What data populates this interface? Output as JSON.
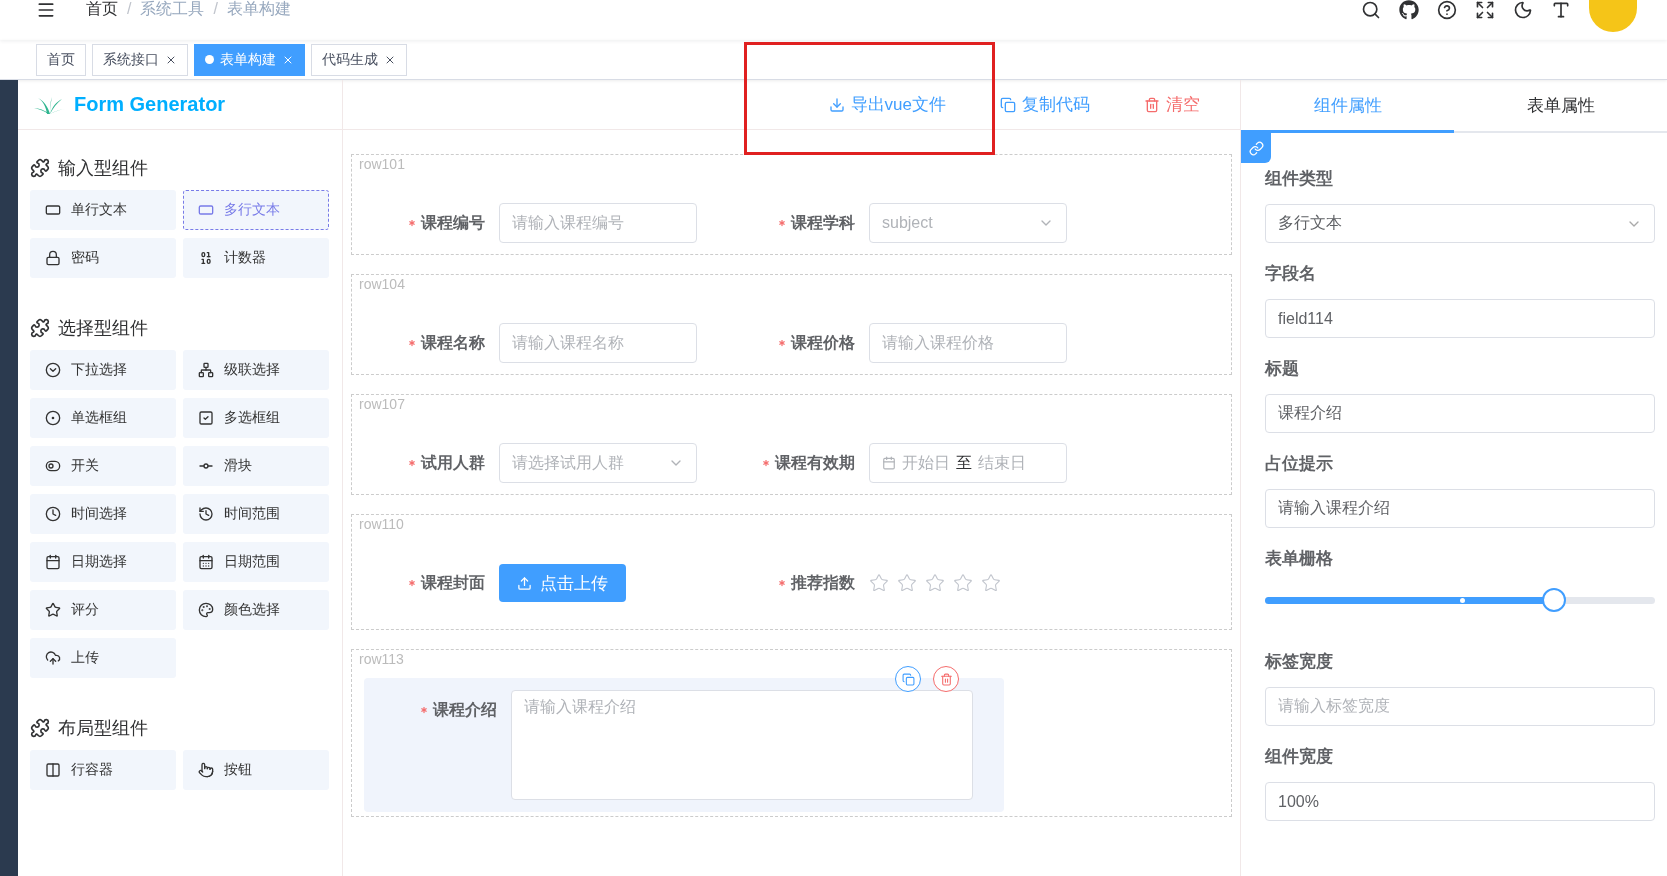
{
  "navbar": {
    "breadcrumb": [
      {
        "label": "首页",
        "link": true
      },
      {
        "separator": "/",
        "label": "系统工具",
        "link": false
      },
      {
        "separator": "/",
        "label": "表单构建",
        "link": false
      }
    ]
  },
  "tags": [
    {
      "label": "首页",
      "selected": false,
      "closable": false
    },
    {
      "label": "系统接口",
      "selected": false,
      "closable": true
    },
    {
      "label": "表单构建",
      "selected": true,
      "closable": true
    },
    {
      "label": "代码生成",
      "selected": false,
      "closable": true
    }
  ],
  "header": {
    "logo": "Form Generator",
    "actions": [
      {
        "kind": "download",
        "label": "导出vue文件"
      },
      {
        "kind": "copy",
        "label": "复制代码"
      },
      {
        "kind": "delete",
        "label": "清空"
      }
    ]
  },
  "palette": [
    {
      "title": "输入型组件",
      "items": [
        {
          "kind": "input",
          "label": "单行文本",
          "selected": false
        },
        {
          "kind": "textarea",
          "label": "多行文本",
          "selected": true
        },
        {
          "kind": "password",
          "label": "密码",
          "selected": false
        },
        {
          "kind": "number",
          "label": "计数器",
          "selected": false
        }
      ]
    },
    {
      "title": "选择型组件",
      "items": [
        {
          "kind": "select",
          "label": "下拉选择",
          "selected": false
        },
        {
          "kind": "cascader",
          "label": "级联选择",
          "selected": false
        },
        {
          "kind": "radio",
          "label": "单选框组",
          "selected": false
        },
        {
          "kind": "checkbox",
          "label": "多选框组",
          "selected": false
        },
        {
          "kind": "switch",
          "label": "开关",
          "selected": false
        },
        {
          "kind": "slider",
          "label": "滑块",
          "selected": false
        },
        {
          "kind": "time",
          "label": "时间选择",
          "selected": false
        },
        {
          "kind": "time-range",
          "label": "时间范围",
          "selected": false
        },
        {
          "kind": "date",
          "label": "日期选择",
          "selected": false
        },
        {
          "kind": "date-range",
          "label": "日期范围",
          "selected": false
        },
        {
          "kind": "rate",
          "label": "评分",
          "selected": false
        },
        {
          "kind": "color",
          "label": "颜色选择",
          "selected": false
        },
        {
          "kind": "upload",
          "label": "上传",
          "selected": false
        }
      ]
    },
    {
      "title": "布局型组件",
      "items": [
        {
          "kind": "row",
          "label": "行容器",
          "selected": false
        },
        {
          "kind": "button",
          "label": "按钮",
          "selected": false
        }
      ]
    }
  ],
  "form": {
    "rows": [
      {
        "label": "row101",
        "active": false,
        "fields": [
          {
            "kind": "input",
            "label": "课程编号",
            "required": true,
            "placeholder": "请输入课程编号"
          },
          {
            "kind": "select",
            "label": "课程学科",
            "required": true,
            "placeholder": "subject"
          }
        ]
      },
      {
        "label": "row104",
        "active": false,
        "fields": [
          {
            "kind": "input",
            "label": "课程名称",
            "required": true,
            "placeholder": "请输入课程名称"
          },
          {
            "kind": "input",
            "label": "课程价格",
            "required": true,
            "placeholder": "请输入课程价格"
          }
        ]
      },
      {
        "label": "row107",
        "active": false,
        "fields": [
          {
            "kind": "select",
            "label": "试用人群",
            "required": true,
            "placeholder": "请选择试用人群"
          },
          {
            "kind": "daterange",
            "label": "课程有效期",
            "required": true,
            "start_placeholder": "开始日",
            "separator": "至",
            "end_placeholder": "结束日"
          }
        ]
      },
      {
        "label": "row110",
        "active": false,
        "fields": [
          {
            "kind": "upload",
            "label": "课程封面",
            "required": true,
            "button": "点击上传"
          },
          {
            "kind": "rate",
            "label": "推荐指数",
            "required": true,
            "stars": 0
          }
        ]
      },
      {
        "label": "row113",
        "active": true,
        "fields": [
          {
            "kind": "textarea",
            "label": "课程介绍",
            "required": true,
            "placeholder": "请输入课程介绍"
          }
        ]
      }
    ]
  },
  "properties": {
    "tabs": [
      {
        "label": "组件属性",
        "selected": true
      },
      {
        "label": "表单属性",
        "selected": false
      }
    ],
    "fields": [
      {
        "kind": "select",
        "label": "组件类型",
        "value": "多行文本"
      },
      {
        "kind": "input",
        "label": "字段名",
        "value": "field114"
      },
      {
        "kind": "input",
        "label": "标题",
        "value": "课程介绍"
      },
      {
        "kind": "input",
        "label": "占位提示",
        "value": "请输入课程介绍"
      },
      {
        "kind": "slider",
        "label": "表单栅格",
        "level": 0.74
      },
      {
        "kind": "input",
        "label": "标签宽度",
        "placeholder": "请输入标签宽度"
      },
      {
        "kind": "input",
        "label": "组件宽度",
        "value": "100%"
      }
    ]
  }
}
